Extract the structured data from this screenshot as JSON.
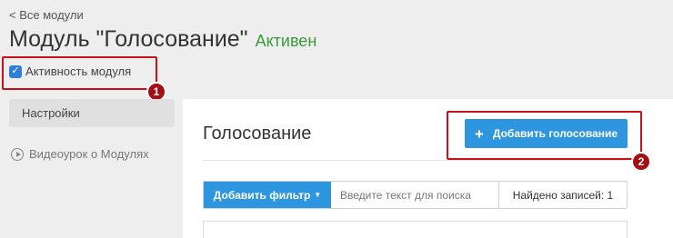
{
  "header": {
    "back_link": "< Все модули",
    "title": "Модуль \"Голосование\"",
    "status": "Активен"
  },
  "module_toggle": {
    "label": "Активность модуля",
    "checked": true
  },
  "sidebar": {
    "settings_tab": "Настройки",
    "video_link": "Видеоурок о Модулях"
  },
  "main": {
    "title": "Голосование",
    "add_button": "Добавить голосование",
    "filter_button": "Добавить фильтр",
    "search_placeholder": "Введите текст для поиска",
    "found_count": "Найдено записей: 1"
  },
  "annotations": {
    "badge_1": "1",
    "badge_2": "2",
    "highlight_color": "#c8111b"
  },
  "colors": {
    "accent": "#2d96de",
    "status": "#3a9a3a"
  }
}
